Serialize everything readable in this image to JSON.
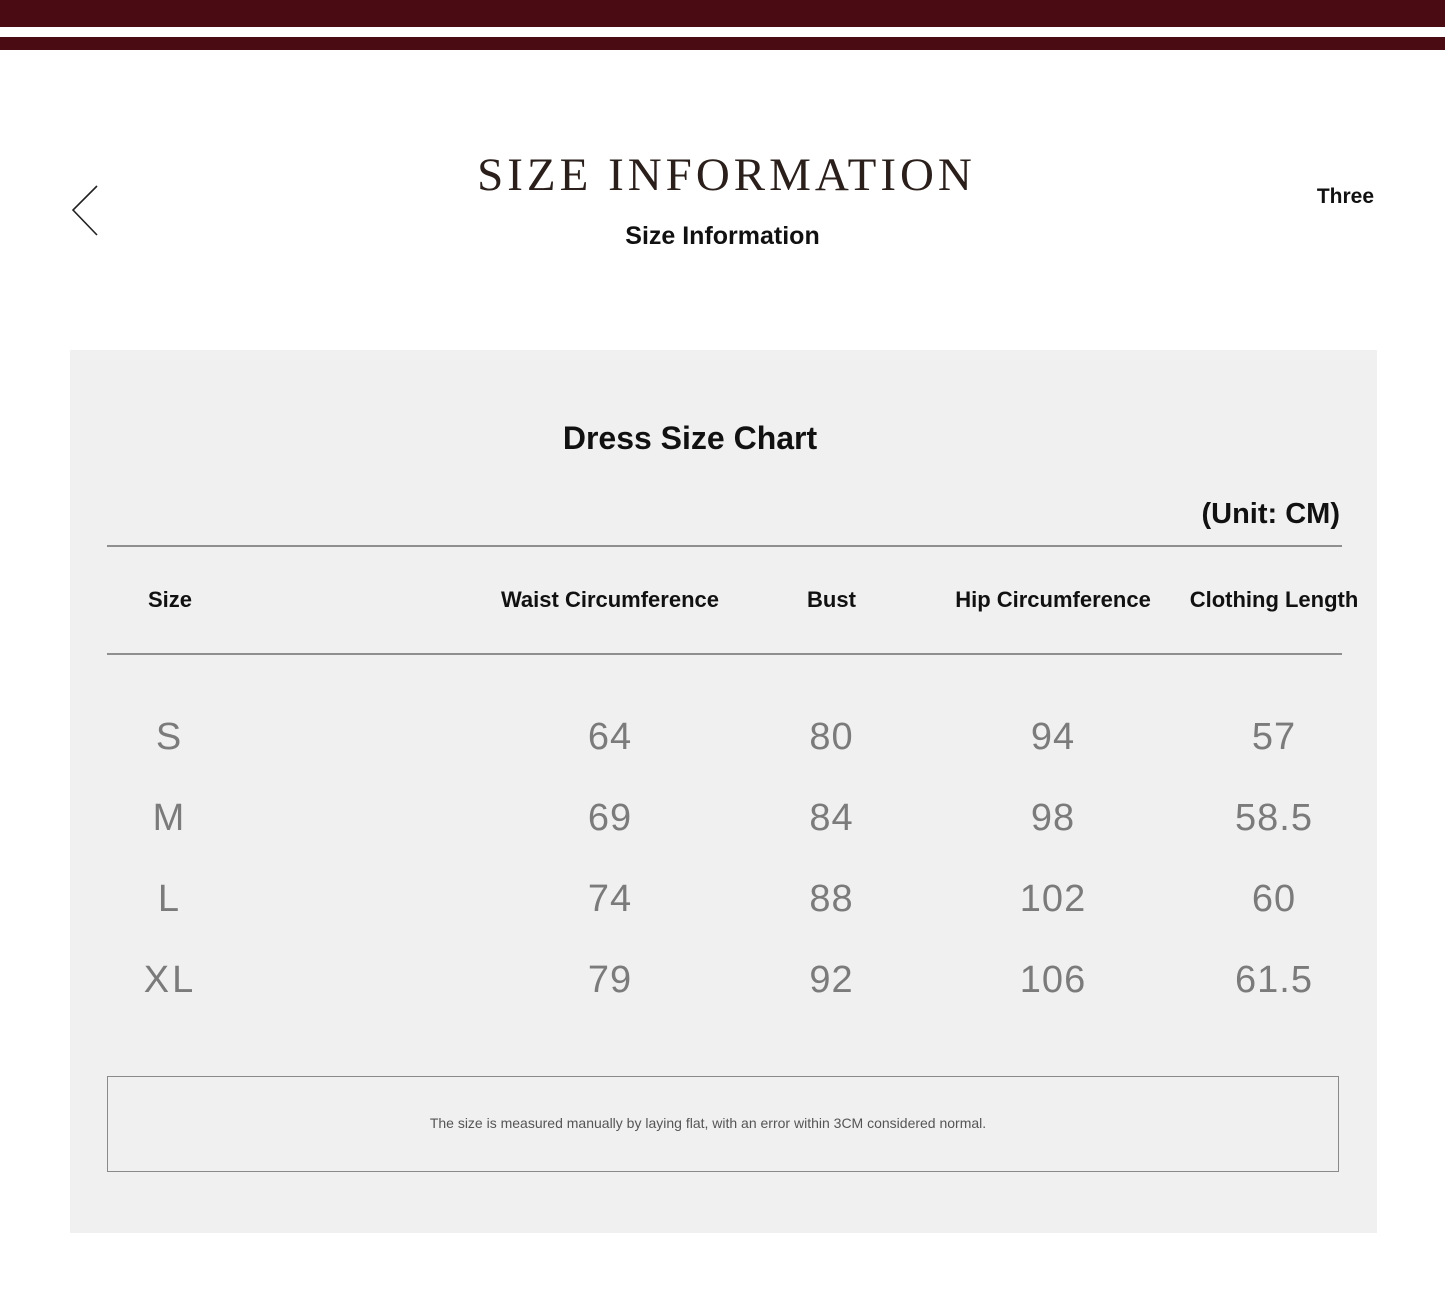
{
  "header": {
    "title": "SIZE INFORMATION",
    "subtitle": "Size Information",
    "right_label": "Three"
  },
  "icons": {
    "back": "chevron-left-icon"
  },
  "colors": {
    "brand_stripe": "#4a0b12",
    "panel_bg": "#f0f0f0",
    "value_text": "#7b7b7b"
  },
  "chart": {
    "title": "Dress Size Chart",
    "unit": "(Unit: CM)",
    "columns": [
      "Size",
      "Waist Circumference",
      "Bust",
      "Hip Circumference",
      "Clothing Length"
    ],
    "rows": [
      [
        "S",
        "64",
        "80",
        "94",
        "57"
      ],
      [
        "M",
        "69",
        "84",
        "98",
        "58.5"
      ],
      [
        "L",
        "74",
        "88",
        "102",
        "60"
      ],
      [
        "XL",
        "79",
        "92",
        "106",
        "61.5"
      ]
    ],
    "note": "The size is measured manually by laying flat, with an error within 3CM considered normal."
  }
}
